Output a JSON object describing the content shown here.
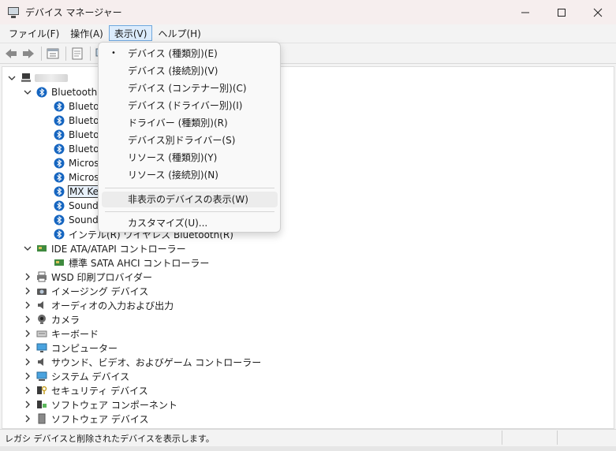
{
  "window": {
    "title": "デバイス マネージャー",
    "minimize_icon": "minimize-icon",
    "maximize_icon": "maximize-icon",
    "close_icon": "close-icon"
  },
  "menubar": {
    "items": [
      {
        "label": "ファイル(F)"
      },
      {
        "label": "操作(A)"
      },
      {
        "label": "表示(V)",
        "open": true
      },
      {
        "label": "ヘルプ(H)"
      }
    ]
  },
  "toolbar": {
    "icons": [
      "back-arrow-icon",
      "forward-arrow-icon",
      "properties-icon",
      "help-icon",
      "monitor-icon"
    ]
  },
  "view_menu": {
    "items": [
      {
        "label": "デバイス (種類別)(E)",
        "checked": true
      },
      {
        "label": "デバイス (接続別)(V)"
      },
      {
        "label": "デバイス (コンテナー別)(C)"
      },
      {
        "label": "デバイス (ドライバー別)(I)"
      },
      {
        "label": "ドライバー (種類別)(R)"
      },
      {
        "label": "デバイス別ドライバー(S)"
      },
      {
        "label": "リソース (種類別)(Y)"
      },
      {
        "label": "リソース (接続別)(N)"
      },
      {
        "label": "非表示のデバイスの表示(W)",
        "highlighted": true
      },
      {
        "label": "カスタマイズ(U)..."
      }
    ],
    "bullet": "•"
  },
  "tree": {
    "bluetooth": {
      "label": "Bluetooth",
      "children": [
        "Blueto",
        "Blueto",
        "Blueto",
        "Blueto",
        "Micros",
        "Micros",
        "MX Ke",
        "Sounde",
        "Sounde",
        "インテル(R) ワイヤレス Bluetooth(R)"
      ]
    },
    "ide": {
      "label": "IDE ATA/ATAPI コントローラー",
      "children": [
        "標準 SATA AHCI コントローラー"
      ]
    },
    "categories": [
      "WSD 印刷プロバイダー",
      "イメージング デバイス",
      "オーディオの入力および出力",
      "カメラ",
      "キーボード",
      "コンピューター",
      "サウンド、ビデオ、およびゲーム コントローラー",
      "システム デバイス",
      "セキュリティ デバイス",
      "ソフトウェア コンポーネント",
      "ソフトウェア デバイス"
    ]
  },
  "statusbar": {
    "text": "レガシ デバイスと削除されたデバイスを表示します。"
  },
  "colors": {
    "bluetooth_blue": "#1565c0",
    "menu_open_bg": "#dcecfc",
    "titlebar_bg": "#f6eeee"
  }
}
